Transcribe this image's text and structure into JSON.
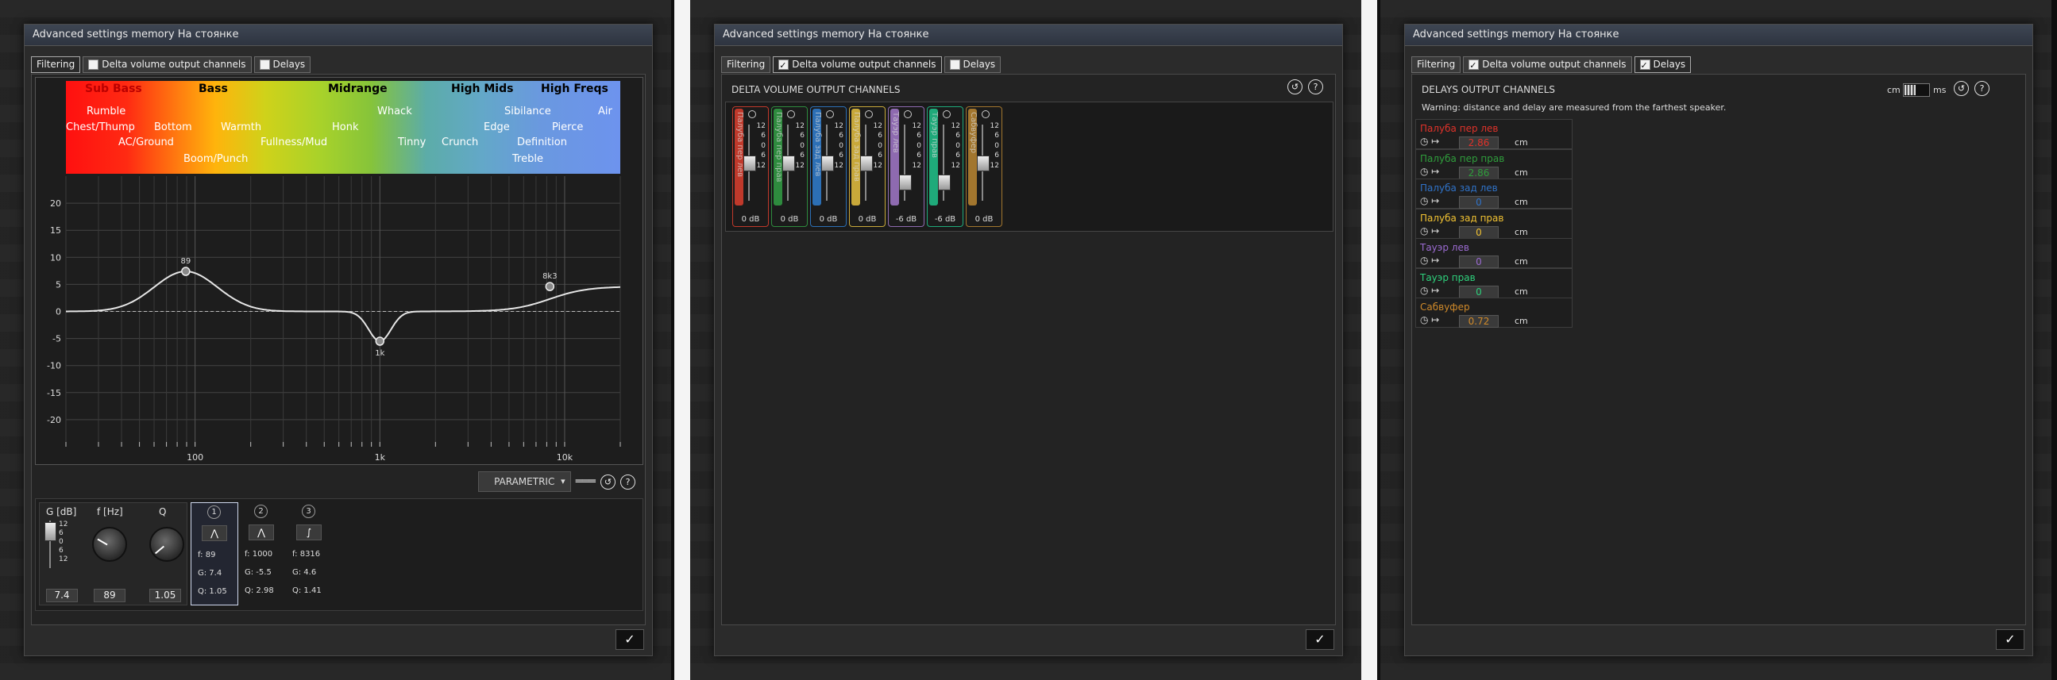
{
  "window_title": "Advanced settings memory На стоянке",
  "tabs": [
    {
      "label": "Filtering"
    },
    {
      "label": "Delta volume output channels"
    },
    {
      "label": "Delays"
    }
  ],
  "ok_icon": "check-icon",
  "filtering": {
    "spectrum_headers": [
      "Sub Bass",
      "Bass",
      "Midrange",
      "High Mids",
      "High Freqs"
    ],
    "spectrum_labels": [
      "Rumble",
      "Chest/Thump",
      "AC/Ground",
      "Bottom",
      "Boom/Punch",
      "Warmth",
      "Fullness/Mud",
      "Honk",
      "Whack",
      "Tinny",
      "Crunch",
      "Edge",
      "Sibilance",
      "Definition",
      "Treble",
      "Pierce",
      "Air"
    ],
    "y_ticks": [
      "20",
      "15",
      "10",
      "5",
      "0",
      "-5",
      "-10",
      "-15",
      "-20"
    ],
    "x_ticks": [
      "100",
      "1k",
      "10k"
    ],
    "points": [
      {
        "label": "89",
        "f": 89,
        "g": 7.4
      },
      {
        "label": "1k",
        "f": 1000,
        "g": -5.5
      },
      {
        "label": "8k3",
        "f": 8316,
        "g": 4.6
      }
    ],
    "mode": "PARAMETRIC",
    "control_headers": [
      "G [dB]",
      "f [Hz]",
      "Q"
    ],
    "gain_ticks": [
      "12",
      "6",
      "0",
      "6",
      "12"
    ],
    "gain_value": "7.4",
    "freq_value": "89",
    "q_value": "1.05",
    "bands": [
      {
        "num": "1",
        "icon": "peak",
        "f": "f: 89",
        "g": "G: 7.4",
        "q": "Q: 1.05"
      },
      {
        "num": "2",
        "icon": "peak",
        "f": "f: 1000",
        "g": "G: -5.5",
        "q": "Q: 2.98"
      },
      {
        "num": "3",
        "icon": "shelf",
        "f": "f: 8316",
        "g": "G: 4.6",
        "q": "Q: 1.41"
      }
    ]
  },
  "delta": {
    "title": "DELTA VOLUME OUTPUT CHANNELS",
    "ticks": [
      "12",
      "6",
      "0",
      "6",
      "12"
    ],
    "channels": [
      {
        "name": "Палуба пер лев",
        "color": "#c0392b",
        "value": "0 dB",
        "level": 0
      },
      {
        "name": "Палуба пер прав",
        "color": "#2e8b3e",
        "value": "0 dB",
        "level": 0
      },
      {
        "name": "Палуба зад лев",
        "color": "#2c6fb5",
        "value": "0 dB",
        "level": 0
      },
      {
        "name": "Палуба зад прав",
        "color": "#c8a83a",
        "value": "0 dB",
        "level": 0
      },
      {
        "name": "Тауэр лев",
        "color": "#8e6ab0",
        "value": "-6 dB",
        "level": -6
      },
      {
        "name": "Тауэр прав",
        "color": "#1faa7a",
        "value": "-6 dB",
        "level": -6
      },
      {
        "name": "Сабвуфер",
        "color": "#a2762e",
        "value": "0 dB",
        "level": 0
      }
    ]
  },
  "delays": {
    "title": "DELAYS OUTPUT CHANNELS",
    "warning": "Warning: distance and delay are measured from the farthest speaker.",
    "unit_left": "cm",
    "unit_right": "ms",
    "entries": [
      {
        "name": "Палуба пер лев",
        "value": "2.86",
        "unit": "cm",
        "color": "#e0322a"
      },
      {
        "name": "Палуба пер прав",
        "value": "2.86",
        "unit": "cm",
        "color": "#2f9e3c"
      },
      {
        "name": "Палуба зад лев",
        "value": "0",
        "unit": "cm",
        "color": "#2f72c8"
      },
      {
        "name": "Палуба зад прав",
        "value": "0",
        "unit": "cm",
        "color": "#f1c232"
      },
      {
        "name": "Тауэр лев",
        "value": "0",
        "unit": "cm",
        "color": "#9b6bd1"
      },
      {
        "name": "Тауэр прав",
        "value": "0",
        "unit": "cm",
        "color": "#2ed17c"
      },
      {
        "name": "Сабвуфер",
        "value": "0.72",
        "unit": "cm",
        "color": "#d08a2a"
      }
    ]
  }
}
